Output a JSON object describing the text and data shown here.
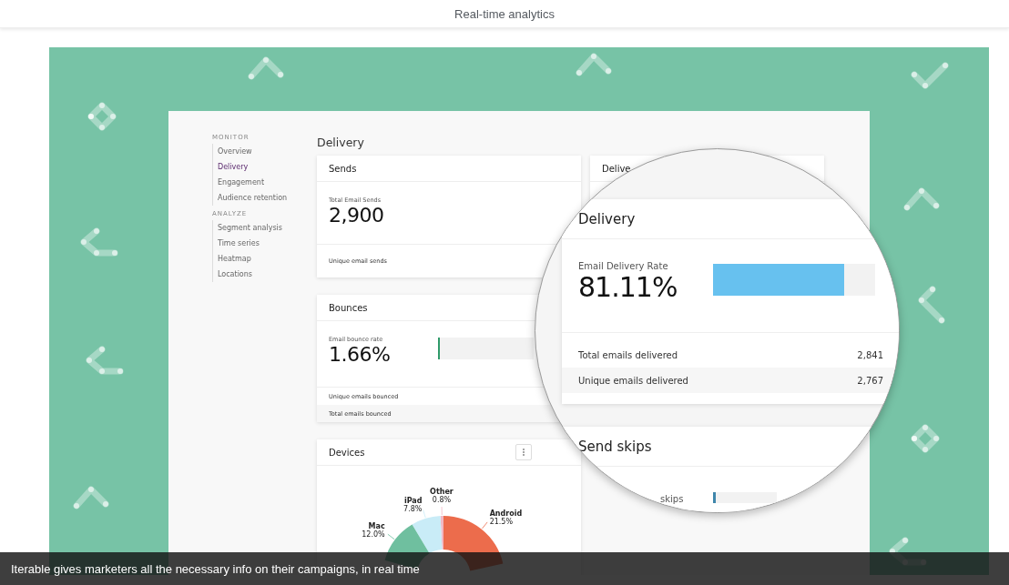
{
  "page_title": "Real-time analytics",
  "sidebar": {
    "sections": [
      {
        "label": "MONITOR",
        "items": [
          {
            "label": "Overview",
            "selected": false
          },
          {
            "label": "Delivery",
            "selected": true
          },
          {
            "label": "Engagement",
            "selected": false
          },
          {
            "label": "Audience retention",
            "selected": false
          }
        ]
      },
      {
        "label": "ANALYZE",
        "items": [
          {
            "label": "Segment analysis",
            "selected": false
          },
          {
            "label": "Time series",
            "selected": false
          },
          {
            "label": "Heatmap",
            "selected": false
          },
          {
            "label": "Locations",
            "selected": false
          }
        ]
      }
    ]
  },
  "main_title": "Delivery",
  "sends": {
    "title": "Sends",
    "metric_label": "Total Email Sends",
    "value": "2,900",
    "rows": [
      {
        "label": "Unique email sends"
      }
    ]
  },
  "bounces": {
    "title": "Bounces",
    "metric_label": "Email bounce rate",
    "value": "1.66%",
    "level": 0.02,
    "rows": [
      {
        "label": "Unique emails bounced"
      },
      {
        "label": "Total emails bounced"
      }
    ]
  },
  "devices": {
    "title": "Devices",
    "chart_data": {
      "type": "donut",
      "categories": [
        "Android",
        "Other",
        "iPad",
        "Mac"
      ],
      "values": [
        21.5,
        0.8,
        7.8,
        12.0
      ],
      "value_labels": [
        "21.5%",
        "0.8%",
        "7.8%",
        "12.0%"
      ]
    }
  },
  "delivery_card": {
    "title": "Delive"
  },
  "magnifier": {
    "delivery": {
      "title": "Delivery",
      "metric_label": "Email Delivery Rate",
      "value": "81.11%",
      "level": 0.81,
      "rows": [
        {
          "label": "Total emails delivered",
          "value": "2,841"
        },
        {
          "label": "Unique emails delivered",
          "value": "2,767"
        }
      ]
    },
    "send_skips": {
      "title": "Send skips",
      "metric_label": "skips",
      "level": 0.02
    }
  },
  "caption": "Iterable gives marketers all the necessary info on their campaigns, in real time"
}
